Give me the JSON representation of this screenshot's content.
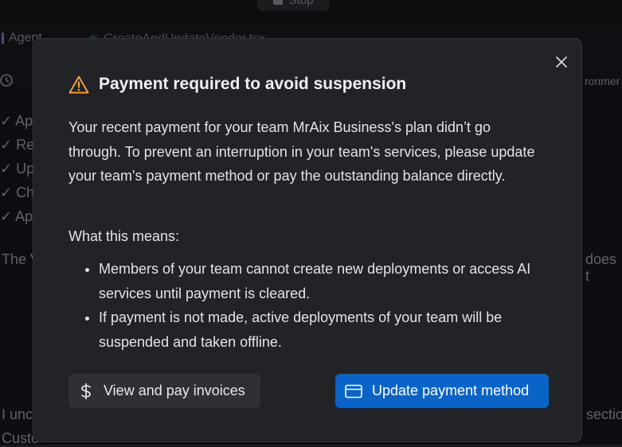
{
  "background": {
    "stop_label": "Stop",
    "agent_tab": "Agent",
    "file_tab": "CreateAndUpdateVendor.tsx",
    "env_text": "ronmer",
    "list_items": [
      "✓ Ap",
      "✓ Re",
      "✓ Up",
      "✓ Ch",
      "✓ Ap"
    ],
    "para1_left": "The V",
    "para1_right": "does t",
    "para2_left": "I unc",
    "para2_right": "sectio",
    "para3_left": "Custo"
  },
  "modal": {
    "title": "Payment required to avoid suspension",
    "title_icon": "warning-icon",
    "accent_color": "#f0a03c",
    "body": "Your recent payment for your team MrAix Business's plan didn’t go through. To prevent an interruption in your team's services, please update your team's payment method or pay the outstanding balance directly.",
    "means_label": "What this means:",
    "means_items": [
      "Members of your team cannot create new deployments or access AI services until payment is cleared.",
      "If payment is not made, active deployments of your team will be suspended and taken offline."
    ],
    "secondary_button": {
      "label": "View and pay invoices",
      "icon": "dollar-icon"
    },
    "primary_button": {
      "label": "Update payment method",
      "icon": "credit-card-icon",
      "color": "#0a64c8"
    },
    "close_icon": "close-icon"
  }
}
